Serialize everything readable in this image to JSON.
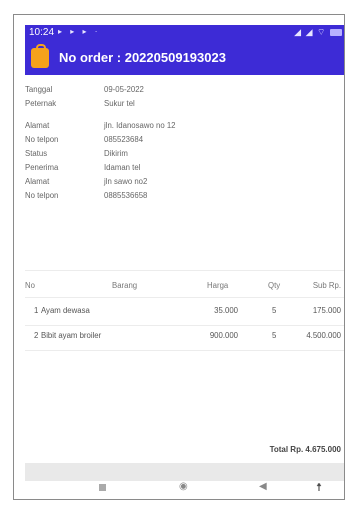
{
  "statusbar": {
    "time": "10:24",
    "left_icons": "▸ ▸ ▸ ·",
    "right_icons": "◢ ◢ ⌔",
    "battery_icon": "battery-icon"
  },
  "appbar": {
    "title": "No order : 20220509193023",
    "icon": "bag-icon"
  },
  "info": [
    {
      "label": "Tanggal",
      "value": "09-05-2022"
    },
    {
      "label": "Peternak",
      "value": "Sukur tel"
    },
    {
      "label": "Alamat",
      "value": "jln. Idanosawo no 12"
    },
    {
      "label": "No telpon",
      "value": "085523684"
    },
    {
      "label": "Status",
      "value": "Dikirim"
    },
    {
      "label": "Penerima",
      "value": "Idaman tel"
    },
    {
      "label": "Alamat",
      "value": "jln sawo no2"
    },
    {
      "label": "No telpon",
      "value": "0885536658"
    }
  ],
  "table": {
    "headers": {
      "no": "No",
      "barang": "Barang",
      "harga": "Harga",
      "qty": "Qty",
      "subtotal": "Sub Rp."
    },
    "rows": [
      {
        "no": "1",
        "barang": "Ayam dewasa",
        "harga": "35.000",
        "qty": "5",
        "subtotal": "175.000"
      },
      {
        "no": "2",
        "barang": "Bibit ayam broiler",
        "harga": "900.000",
        "qty": "5",
        "subtotal": "4.500.000"
      }
    ]
  },
  "total": "Total Rp. 4.675.000",
  "navbar": {
    "recent": "recent-apps-icon",
    "home": "home-icon",
    "back": "back-icon",
    "accessibility": "accessibility-icon"
  },
  "colors": {
    "primary": "#3d2bd6",
    "accent": "#f5a21b"
  }
}
